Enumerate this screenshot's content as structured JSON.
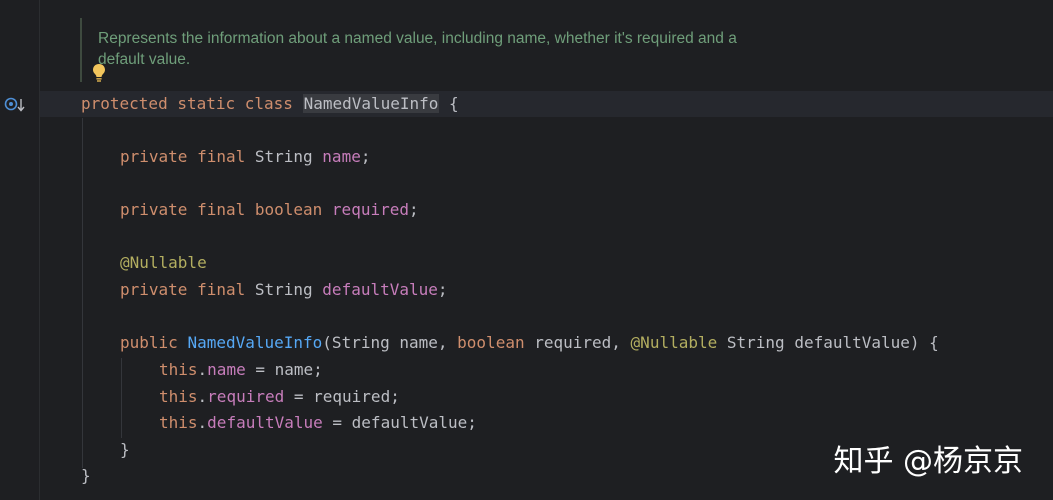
{
  "doc_comment": {
    "line1": "Represents the information about a named value, including name, whether it's required and a",
    "line2": "default value."
  },
  "code": {
    "l1": {
      "kw": "protected static class ",
      "cls": "NamedValueInfo",
      "rest": " {"
    },
    "l2": {
      "kw": "private final ",
      "type": "String ",
      "field": "name",
      "rest": ";"
    },
    "l3": {
      "kw": "private final boolean ",
      "field": "required",
      "rest": ";"
    },
    "l4": {
      "ann": "@Nullable"
    },
    "l5": {
      "kw": "private final ",
      "type": "String ",
      "field": "defaultValue",
      "rest": ";"
    },
    "l6": {
      "kw": "public ",
      "fn": "NamedValueInfo",
      "p1": "(String name, ",
      "kw2": "boolean ",
      "p2": "required, ",
      "ann": "@Nullable",
      "p3": " String defaultValue) {"
    },
    "l7": {
      "kw": "this",
      "dot": ".",
      "field": "name",
      "rest": " = name;"
    },
    "l8": {
      "kw": "this",
      "dot": ".",
      "field": "required",
      "rest": " = required;"
    },
    "l9": {
      "kw": "this",
      "dot": ".",
      "field": "defaultValue",
      "rest": " = defaultValue;"
    },
    "l10": {
      "rest": "}"
    },
    "l11": {
      "rest": "}"
    }
  },
  "watermark": "知乎 @杨京京",
  "icons": {
    "gutter": "implementations-icon",
    "intention": "lightbulb-icon"
  }
}
